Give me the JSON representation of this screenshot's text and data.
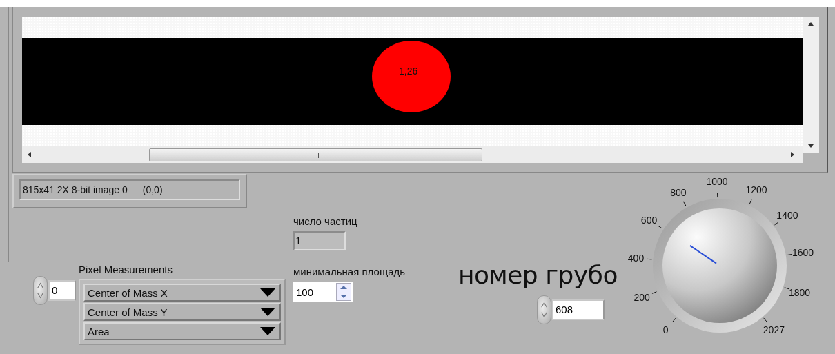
{
  "image_display": {
    "overlay_label": "1,26",
    "info": "815x41 2X 8-bit image 0",
    "coordinates": "(0,0)"
  },
  "pixel_measurements": {
    "label": "Pixel Measurements",
    "index": "0",
    "items": [
      {
        "value": "Center of Mass X"
      },
      {
        "value": "Center of Mass Y"
      },
      {
        "value": "Area"
      }
    ]
  },
  "particle_count": {
    "label": "число частиц",
    "value": "1"
  },
  "min_area": {
    "label": "минимальная площадь",
    "value": "100"
  },
  "coarse_number": {
    "label": "номер грубо",
    "value": "608",
    "scale_labels": [
      "0",
      "200",
      "400",
      "600",
      "800",
      "1000",
      "1200",
      "1400",
      "1600",
      "1800",
      "2027"
    ]
  }
}
